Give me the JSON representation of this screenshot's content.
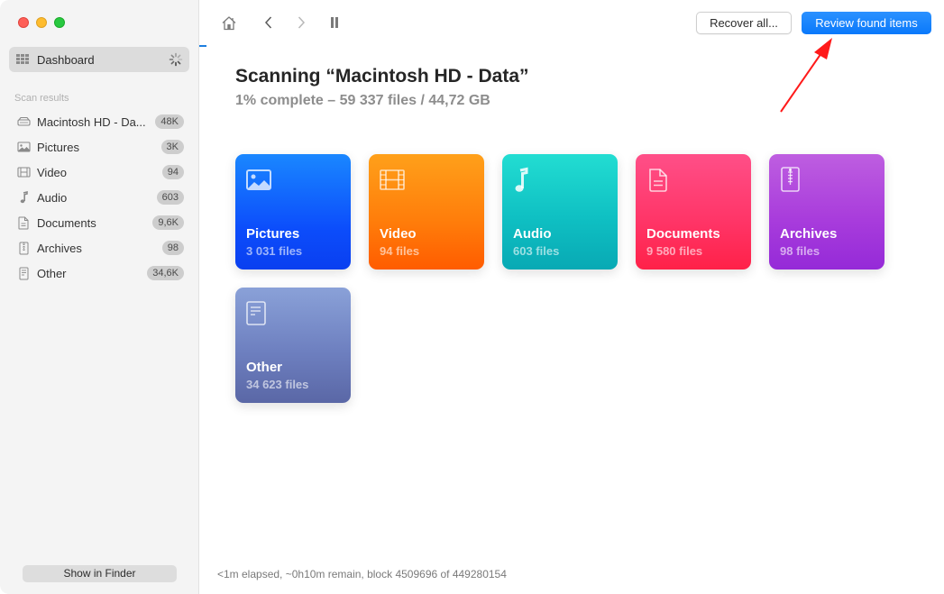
{
  "sidebar": {
    "dashboard": {
      "label": "Dashboard",
      "icon": "grid-icon",
      "status_icon": "spinner-icon"
    },
    "section_title": "Scan results",
    "items": [
      {
        "label": "Macintosh HD - Data",
        "display_label": "Macintosh HD - Da...",
        "badge": "48K",
        "icon": "drive-icon"
      },
      {
        "label": "Pictures",
        "badge": "3K",
        "icon": "picture-icon"
      },
      {
        "label": "Video",
        "badge": "94",
        "icon": "film-icon"
      },
      {
        "label": "Audio",
        "badge": "603",
        "icon": "music-note-icon"
      },
      {
        "label": "Documents",
        "badge": "9,6K",
        "icon": "document-icon"
      },
      {
        "label": "Archives",
        "badge": "98",
        "icon": "archive-icon"
      },
      {
        "label": "Other",
        "badge": "34,6K",
        "icon": "file-icon"
      }
    ],
    "show_in_finder": "Show in Finder"
  },
  "toolbar": {
    "home": "home-icon",
    "back": "chevron-left-icon",
    "forward": "chevron-right-icon",
    "pause": "pause-icon",
    "recover_all": "Recover all...",
    "review_found": "Review found items"
  },
  "scan": {
    "progress_percent": 1,
    "title": "Scanning “Macintosh HD - Data”",
    "subtitle": "1% complete – 59 337 files / 44,72 GB",
    "status": "<1m elapsed, ~0h10m remain, block 4509696 of 449280154"
  },
  "cards": [
    {
      "name": "Pictures",
      "count": "3 031 files",
      "icon": "picture-icon",
      "color": "#0c4dfb"
    },
    {
      "name": "Video",
      "count": "94 files",
      "icon": "film-icon",
      "color": "#ff7c0a"
    },
    {
      "name": "Audio",
      "count": "603 files",
      "icon": "music-note-icon",
      "color": "#0fc0c3"
    },
    {
      "name": "Documents",
      "count": "9 580 files",
      "icon": "document-icon",
      "color": "#ff3466"
    },
    {
      "name": "Archives",
      "count": "98 files",
      "icon": "archive-icon",
      "color": "#a93ddc"
    },
    {
      "name": "Other",
      "count": "34 623 files",
      "icon": "file-icon",
      "color": "#6e80c0"
    }
  ],
  "annotation": {
    "type": "red-arrow",
    "points_to": "Review found items",
    "color": "#ff0000"
  }
}
